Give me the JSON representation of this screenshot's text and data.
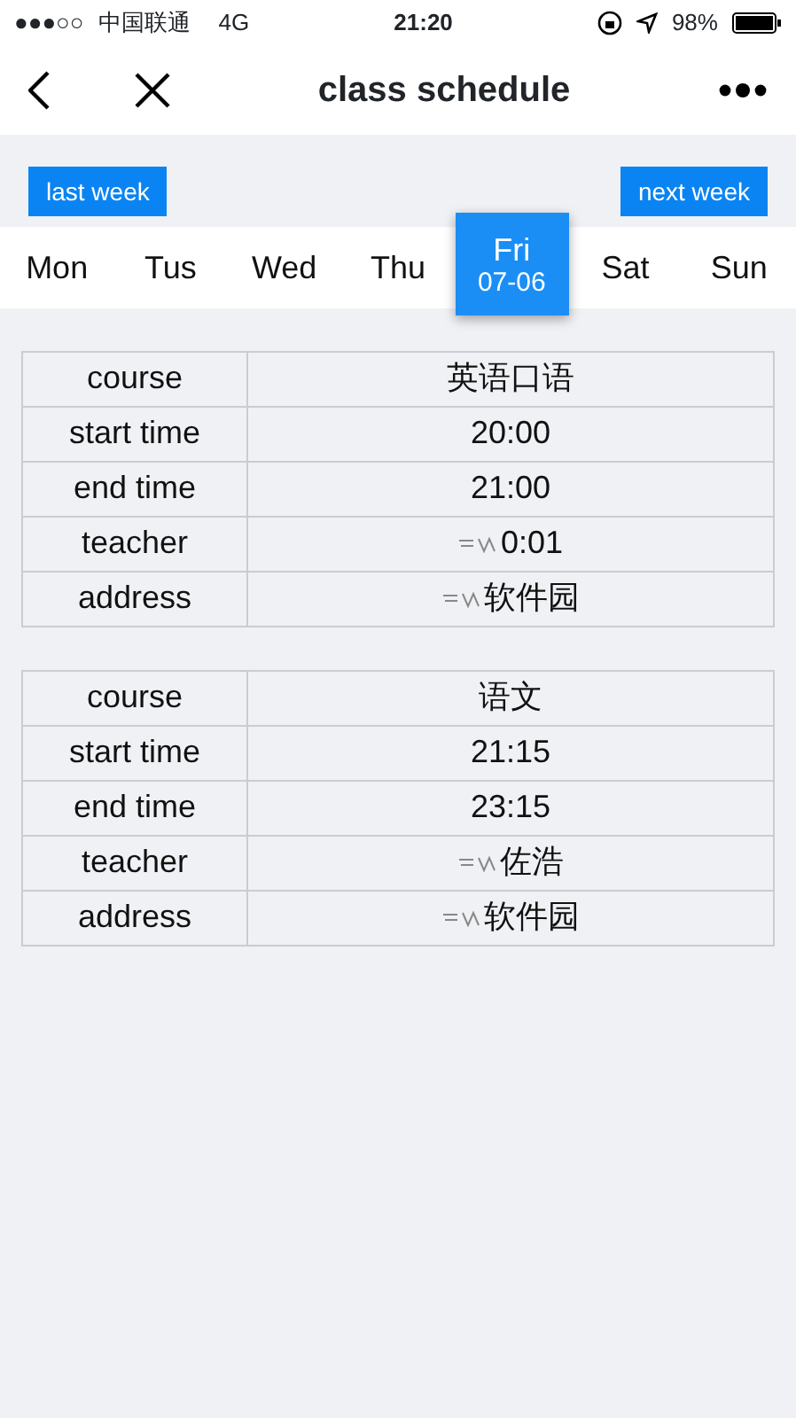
{
  "status_bar": {
    "signal": "●●●○○",
    "carrier": "中国联通",
    "network": "4G",
    "time": "21:20",
    "battery": "98%"
  },
  "nav": {
    "title": "class schedule"
  },
  "week_buttons": [
    "last week",
    "next week"
  ],
  "days": [
    {
      "label": "Mon",
      "selected": false
    },
    {
      "label": "Tus",
      "selected": false
    },
    {
      "label": "Wed",
      "selected": false
    },
    {
      "label": "Thu",
      "selected": false
    },
    {
      "label": "Fri",
      "date": "07-06",
      "selected": true
    },
    {
      "label": "Sat",
      "selected": false
    },
    {
      "label": "Sun",
      "selected": false
    }
  ],
  "courses": [
    {
      "rows": [
        {
          "label": "course",
          "value": "英语口语"
        },
        {
          "label": "start time",
          "value": "20:00"
        },
        {
          "label": "end time",
          "value": "21:00"
        },
        {
          "label": "teacher",
          "value": "0:01",
          "redacted": true
        },
        {
          "label": "address",
          "value": "软件园",
          "redacted": true
        }
      ]
    },
    {
      "rows": [
        {
          "label": "course",
          "value": "语文"
        },
        {
          "label": "start time",
          "value": "21:15"
        },
        {
          "label": "end time",
          "value": "23:15"
        },
        {
          "label": "teacher",
          "value": "佐浩",
          "redacted": true
        },
        {
          "label": "address",
          "value": "软件园",
          "redacted": true
        }
      ]
    }
  ]
}
